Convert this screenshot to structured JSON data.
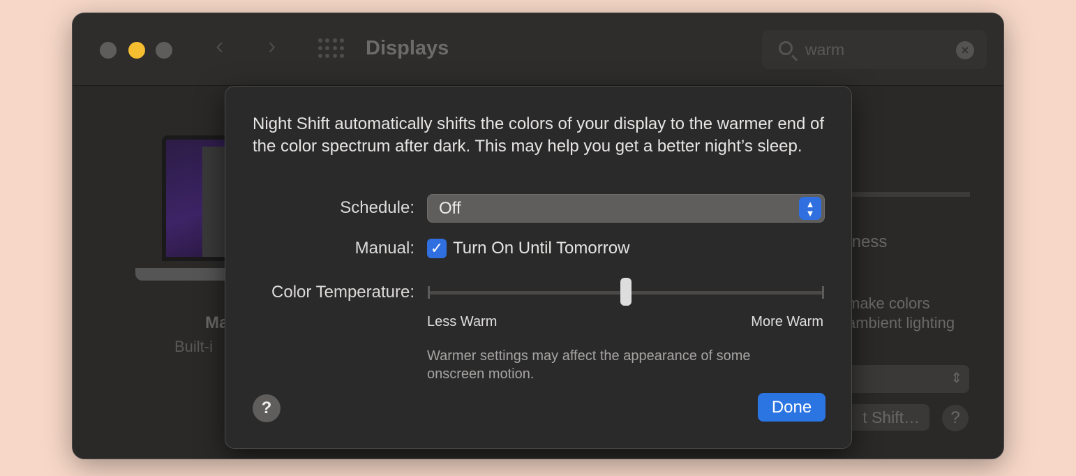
{
  "window": {
    "title": "Displays",
    "nav_back": "‹",
    "nav_forward": "›",
    "search_value": "warm",
    "search_clear": "×"
  },
  "background": {
    "display_name": "Ma",
    "display_sub": "Built-i",
    "brightness_fragment": "tness",
    "colors_line1": "make colors",
    "colors_line2": "ambient lighting",
    "select_arrows": "⇕",
    "night_shift_button": "t Shift…",
    "help": "?"
  },
  "sheet": {
    "intro": "Night Shift automatically shifts the colors of your display to the warmer end of the color spectrum after dark. This may help you get a better night’s sleep.",
    "schedule_label": "Schedule:",
    "schedule_value": "Off",
    "stepper_glyph": "⌃⌄",
    "manual_label": "Manual:",
    "manual_checked": true,
    "manual_check_glyph": "✓",
    "manual_option": "Turn On Until Tomorrow",
    "temp_label": "Color Temperature:",
    "temp_value": 0.5,
    "temp_min_label": "Less Warm",
    "temp_max_label": "More Warm",
    "warning": "Warmer settings may affect the appearance of some onscreen motion.",
    "help": "?",
    "done_label": "Done"
  },
  "colors": {
    "accent": "#2b75e3",
    "minimize": "#f5bd30",
    "desktop": "#f7d8c8"
  }
}
